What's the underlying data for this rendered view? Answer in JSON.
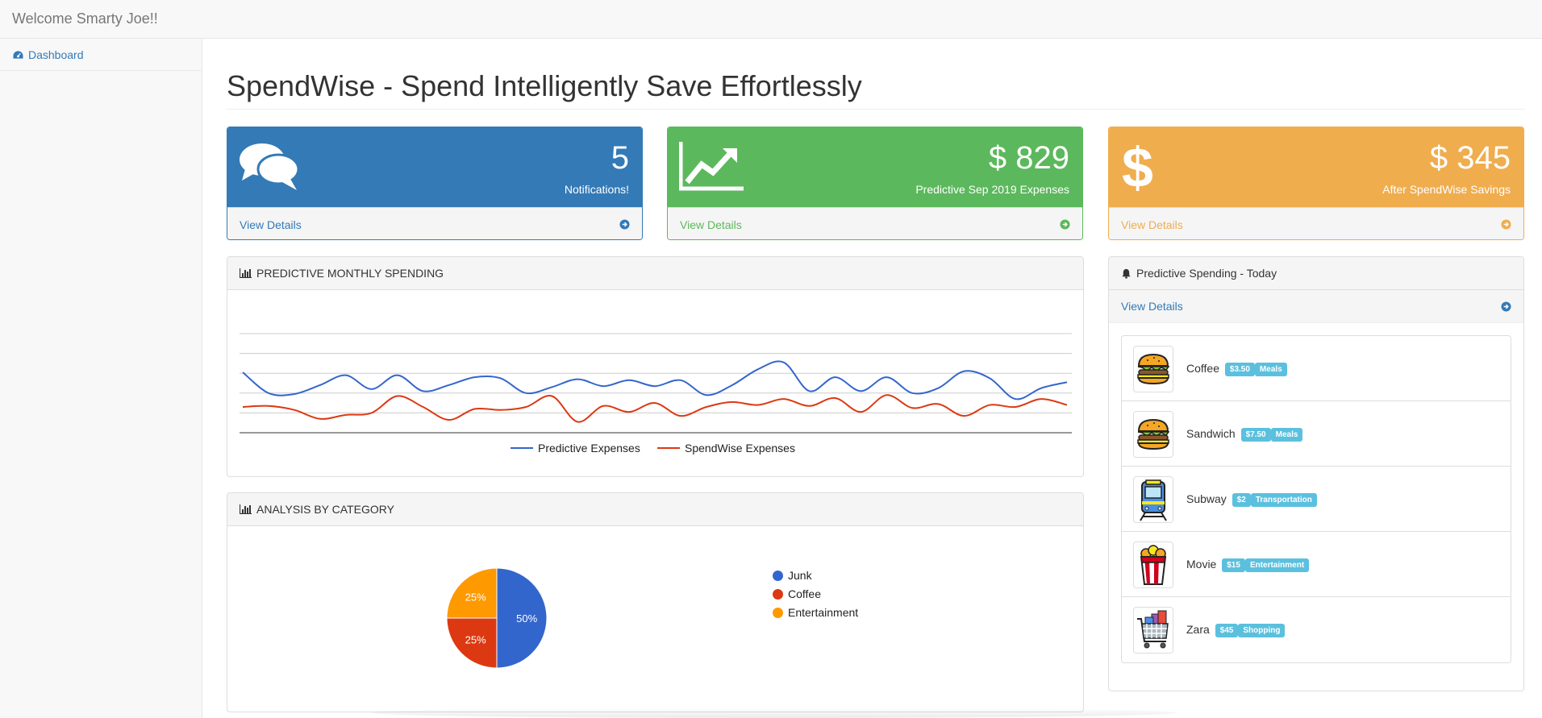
{
  "header": {
    "brand": "Welcome Smarty Joe!!"
  },
  "sidebar": {
    "items": [
      {
        "label": "Dashboard",
        "icon": "dashboard-icon"
      }
    ]
  },
  "page": {
    "title": "SpendWise - Spend Intelligently Save Effortlessly"
  },
  "cards": [
    {
      "number": "5",
      "subtitle": "Notifications!",
      "link": "View Details",
      "icon": "comments-icon",
      "color": "#337ab7"
    },
    {
      "number": "$ 829",
      "subtitle": "Predictive Sep 2019 Expenses",
      "link": "View Details",
      "icon": "line-chart-icon",
      "color": "#5cb85c"
    },
    {
      "number": "$ 345",
      "subtitle": "After SpendWise Savings",
      "link": "View Details",
      "icon": "dollar-icon",
      "color": "#f0ad4e"
    }
  ],
  "line_panel": {
    "title": "PREDICTIVE MONTHLY SPENDING"
  },
  "pie_panel": {
    "title": "ANALYSIS BY CATEGORY"
  },
  "today_panel": {
    "title": "Predictive Spending - Today",
    "link": "View Details",
    "items": [
      {
        "name": "Coffee",
        "amount": "$3.50",
        "category": "Meals",
        "icon": "burger-icon"
      },
      {
        "name": "Sandwich",
        "amount": "$7.50",
        "category": "Meals",
        "icon": "burger-icon"
      },
      {
        "name": "Subway",
        "amount": "$2",
        "category": "Transportation",
        "icon": "train-icon"
      },
      {
        "name": "Movie",
        "amount": "$15",
        "category": "Entertainment",
        "icon": "popcorn-icon"
      },
      {
        "name": "Zara",
        "amount": "$45",
        "category": "Shopping",
        "icon": "shopping-cart-icon"
      }
    ]
  },
  "chart_data": [
    {
      "type": "line",
      "grid": true,
      "legend": "bottom",
      "ylim": [
        0,
        100
      ],
      "series": [
        {
          "name": "Predictive Expenses",
          "color": "#3366cc",
          "values": [
            61,
            40,
            39,
            48,
            58,
            44,
            58,
            42,
            48,
            56,
            55,
            40,
            46,
            54,
            47,
            53,
            47,
            53,
            38,
            48,
            64,
            71,
            42,
            56,
            42,
            56,
            40,
            45,
            62,
            55,
            34,
            45,
            51
          ]
        },
        {
          "name": "SpendWise Expenses",
          "color": "#dc3912",
          "values": [
            26,
            27,
            23,
            14,
            18,
            20,
            37,
            26,
            13,
            24,
            23,
            26,
            37,
            11,
            27,
            21,
            30,
            17,
            26,
            31,
            28,
            34,
            27,
            35,
            21,
            38,
            25,
            29,
            17,
            28,
            26,
            34,
            28
          ]
        }
      ]
    },
    {
      "type": "pie",
      "legend": "right",
      "slices": [
        {
          "label": "Junk",
          "value": 50,
          "text": "50%",
          "color": "#3366cc"
        },
        {
          "label": "Coffee",
          "value": 25,
          "text": "25%",
          "color": "#dc3912"
        },
        {
          "label": "Entertainment",
          "value": 25,
          "text": "25%",
          "color": "#ff9900"
        }
      ]
    }
  ]
}
